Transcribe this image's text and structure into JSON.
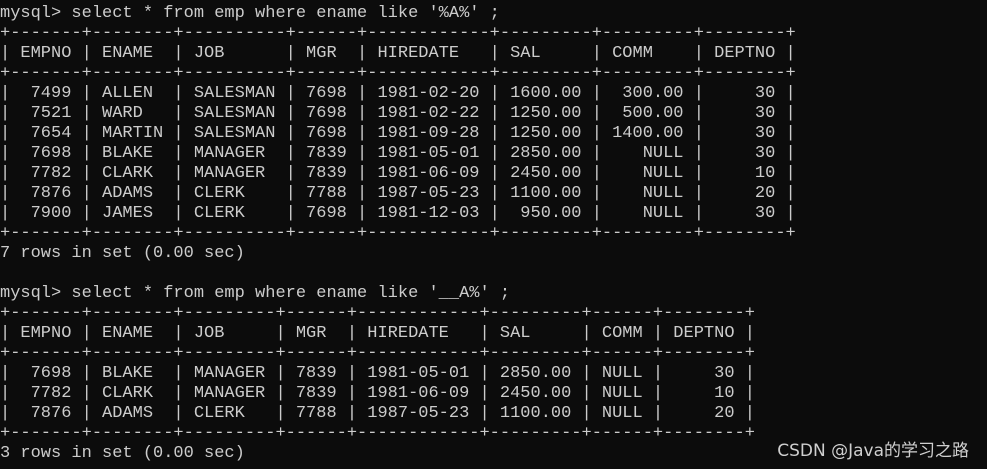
{
  "terminal": {
    "lines": [
      "mysql> select * from emp where ename like '%A%' ;",
      "+-------+--------+----------+------+------------+---------+---------+--------+",
      "| EMPNO | ENAME  | JOB      | MGR  | HIREDATE   | SAL     | COMM    | DEPTNO |",
      "+-------+--------+----------+------+------------+---------+---------+--------+",
      "|  7499 | ALLEN  | SALESMAN | 7698 | 1981-02-20 | 1600.00 |  300.00 |     30 |",
      "|  7521 | WARD   | SALESMAN | 7698 | 1981-02-22 | 1250.00 |  500.00 |     30 |",
      "|  7654 | MARTIN | SALESMAN | 7698 | 1981-09-28 | 1250.00 | 1400.00 |     30 |",
      "|  7698 | BLAKE  | MANAGER  | 7839 | 1981-05-01 | 2850.00 |    NULL |     30 |",
      "|  7782 | CLARK  | MANAGER  | 7839 | 1981-06-09 | 2450.00 |    NULL |     10 |",
      "|  7876 | ADAMS  | CLERK    | 7788 | 1987-05-23 | 1100.00 |    NULL |     20 |",
      "|  7900 | JAMES  | CLERK    | 7698 | 1981-12-03 |  950.00 |    NULL |     30 |",
      "+-------+--------+----------+------+------------+---------+---------+--------+",
      "7 rows in set (0.00 sec)",
      "",
      "mysql> select * from emp where ename like '__A%' ;",
      "+-------+--------+---------+------+------------+---------+------+--------+",
      "| EMPNO | ENAME  | JOB     | MGR  | HIREDATE   | SAL     | COMM | DEPTNO |",
      "+-------+--------+---------+------+------------+---------+------+--------+",
      "|  7698 | BLAKE  | MANAGER | 7839 | 1981-05-01 | 2850.00 | NULL |     30 |",
      "|  7782 | CLARK  | MANAGER | 7839 | 1981-06-09 | 2450.00 | NULL |     10 |",
      "|  7876 | ADAMS  | CLERK   | 7788 | 1987-05-23 | 1100.00 | NULL |     20 |",
      "+-------+--------+---------+------+------------+---------+------+--------+",
      "3 rows in set (0.00 sec)"
    ]
  },
  "watermark": {
    "text": "CSDN @Java的学习之路"
  },
  "colors": {
    "background": "#0c0c0c",
    "foreground": "#cccccc"
  }
}
